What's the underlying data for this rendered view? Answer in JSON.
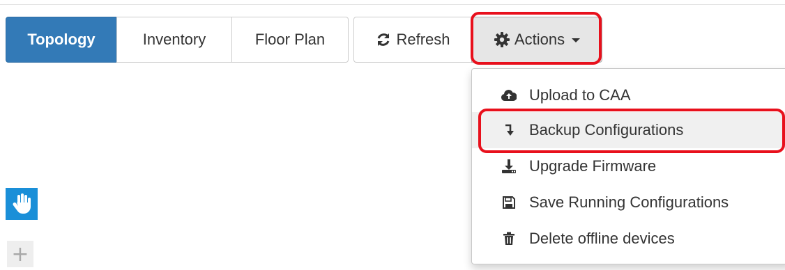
{
  "tabs": [
    {
      "label": "Topology",
      "active": true
    },
    {
      "label": "Inventory",
      "active": false
    },
    {
      "label": "Floor Plan",
      "active": false
    }
  ],
  "toolbar": {
    "refresh_label": "Refresh",
    "refresh_icon": "refresh-icon",
    "actions_label": "Actions",
    "actions_icon": "gear-icon"
  },
  "actions_menu": {
    "items": [
      {
        "label": "Upload to CAA",
        "icon": "cloud-upload-icon"
      },
      {
        "label": "Backup Configurations",
        "icon": "arrow-turn-down-icon"
      },
      {
        "label": "Upgrade Firmware",
        "icon": "download-icon"
      },
      {
        "label": "Save Running Configurations",
        "icon": "save-icon"
      },
      {
        "label": "Delete offline devices",
        "icon": "trash-icon"
      }
    ]
  },
  "side_tools": {
    "pan_icon": "hand-icon",
    "zoom_in_label": "+"
  },
  "colors": {
    "active_tab": "#337ab7",
    "highlight": "#e8101c",
    "pan_tool": "#1a8fd8"
  }
}
